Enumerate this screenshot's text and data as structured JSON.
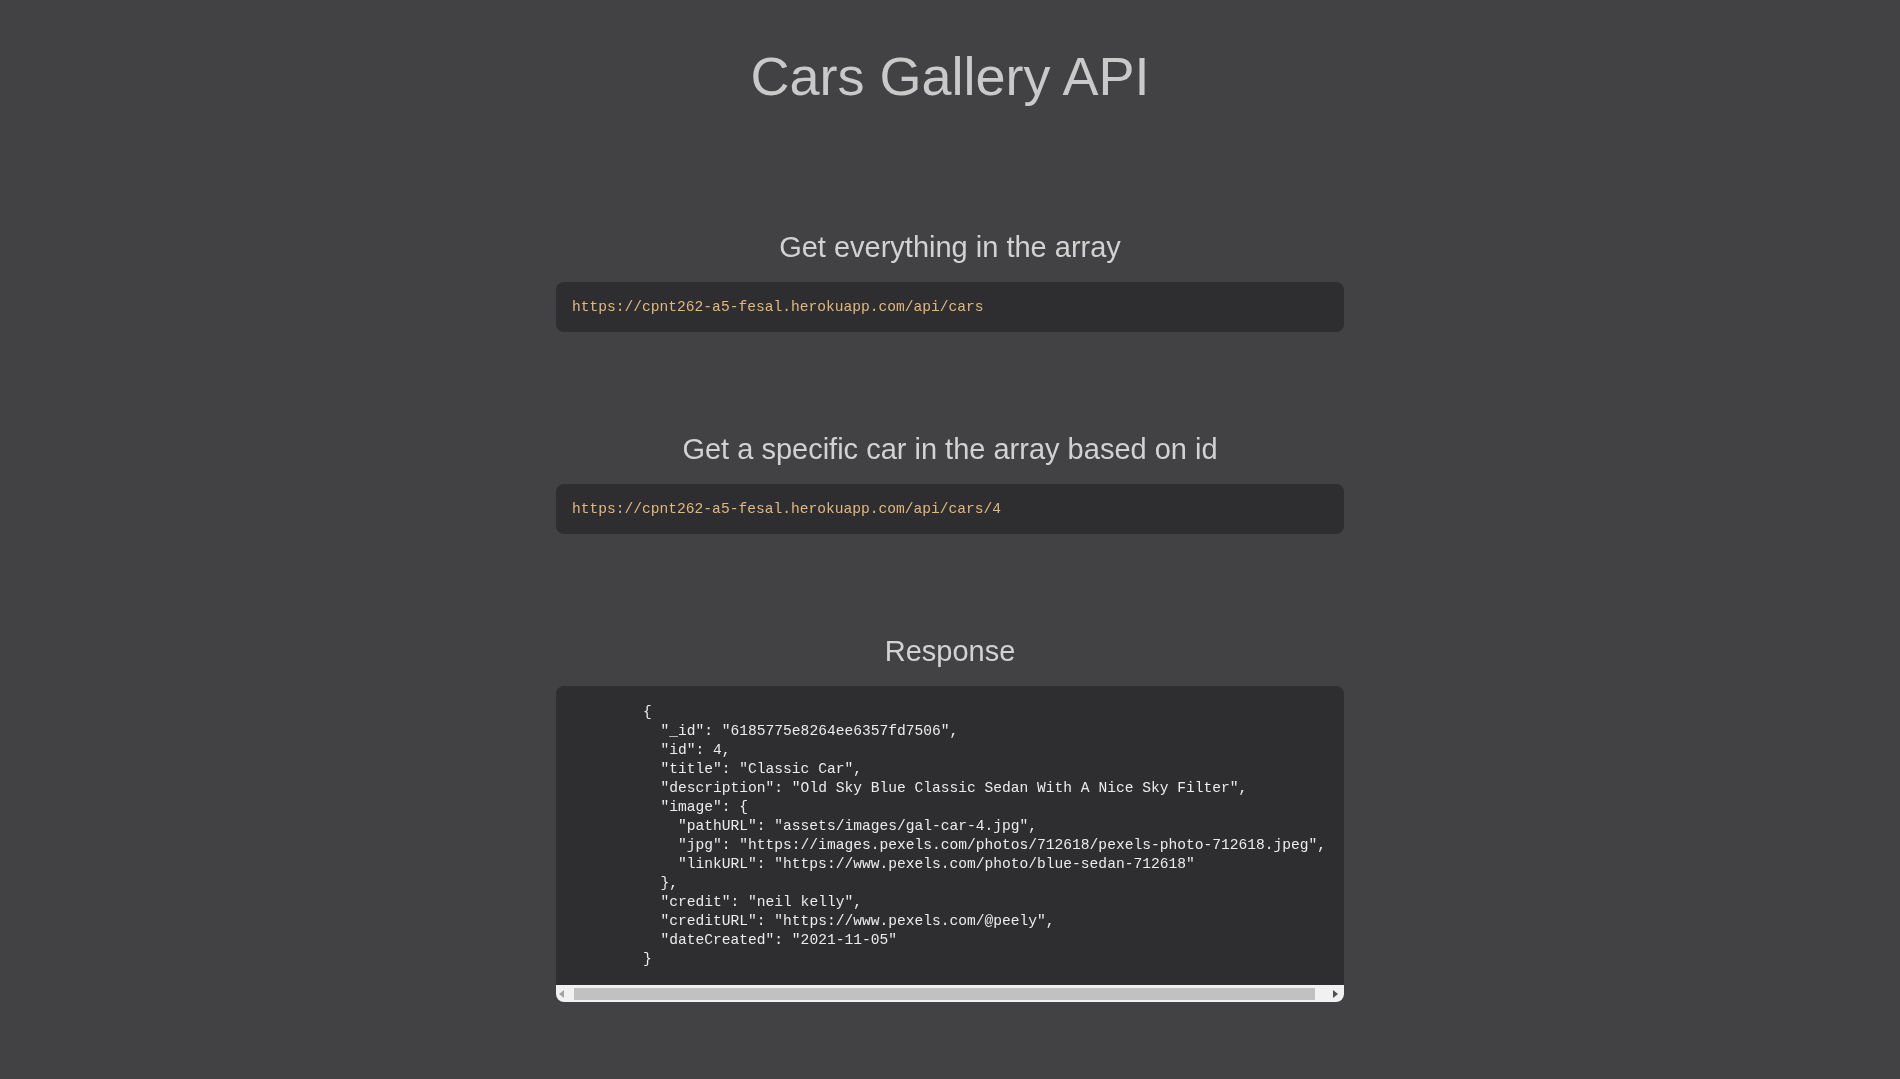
{
  "title": "Cars Gallery API",
  "sections": [
    {
      "heading": "Get everything in the array",
      "kind": "url",
      "url": "https://cpnt262-a5-fesal.herokuapp.com/api/cars"
    },
    {
      "heading": "Get a specific car in the array based on id",
      "kind": "url",
      "url": "https://cpnt262-a5-fesal.herokuapp.com/api/cars/4"
    },
    {
      "heading": "Response",
      "kind": "json",
      "lines": [
        {
          "text": "{",
          "children": [
            {
              "text": "\"_id\": \"6185775e8264ee6357fd7506\","
            },
            {
              "text": "\"id\": 4,"
            },
            {
              "text": "\"title\": \"Classic Car\","
            },
            {
              "text": "\"description\": \"Old Sky Blue Classic Sedan With A Nice Sky Filter\","
            },
            {
              "text": "\"image\": {",
              "children": [
                {
                  "text": "\"pathURL\": \"assets/images/gal-car-4.jpg\","
                },
                {
                  "text": "\"jpg\": \"https://images.pexels.com/photos/712618/pexels-photo-712618.jpeg\","
                },
                {
                  "text": "\"linkURL\": \"https://www.pexels.com/photo/blue-sedan-712618\""
                }
              ]
            },
            {
              "text": "},"
            },
            {
              "text": "\"credit\": \"neil kelly\","
            },
            {
              "text": "\"creditURL\": \"https://www.pexels.com/@peely\","
            },
            {
              "text": "\"dateCreated\": \"2021-11-05\""
            }
          ]
        },
        {
          "text": "}"
        }
      ]
    }
  ]
}
